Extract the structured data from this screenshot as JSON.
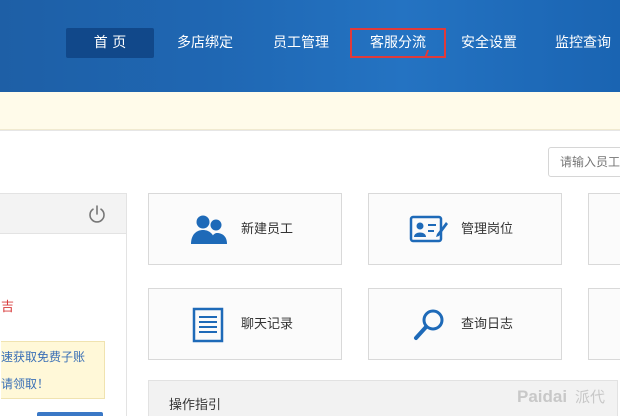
{
  "nav": {
    "items": [
      {
        "label": "首 页",
        "state": "active"
      },
      {
        "label": "多店绑定",
        "state": "normal"
      },
      {
        "label": "员工管理",
        "state": "normal"
      },
      {
        "label": "客服分流",
        "state": "highlighted"
      },
      {
        "label": "安全设置",
        "state": "normal"
      },
      {
        "label": "监控查询",
        "state": "normal"
      }
    ]
  },
  "search": {
    "placeholder": "请输入员工"
  },
  "left_panel": {
    "power_icon": "power-icon",
    "red_text": "吉",
    "note_lines": [
      "速获取免费子账",
      "请领取！"
    ]
  },
  "cards": [
    {
      "label": "新建员工",
      "icon": "users-icon"
    },
    {
      "label": "管理岗位",
      "icon": "id-card-icon"
    },
    {
      "label": "聊天记录",
      "icon": "document-icon"
    },
    {
      "label": "查询日志",
      "icon": "magnifier-icon"
    }
  ],
  "guide": {
    "title": "操作指引"
  },
  "watermark": {
    "latin": "Paidai",
    "cjk": "派代"
  },
  "colors": {
    "nav_bg": "#1f67b3",
    "nav_active": "#11488a",
    "highlight_border": "#e03a3a",
    "icon_blue": "#1e6ab8",
    "notice_bg": "#fffbea"
  }
}
